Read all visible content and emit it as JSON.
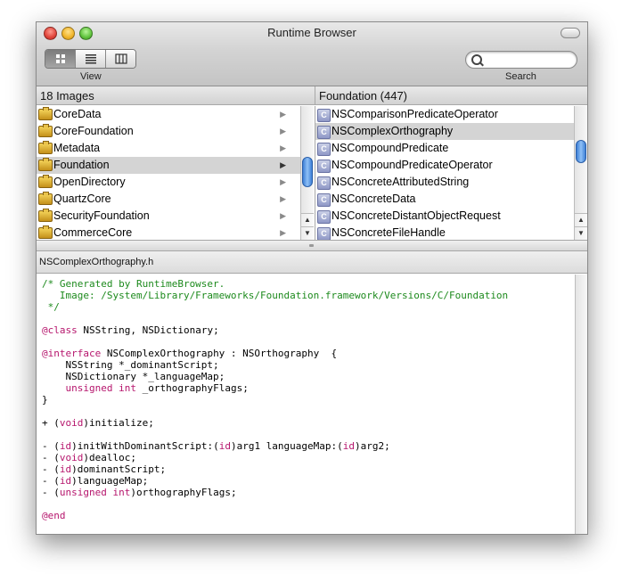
{
  "window": {
    "title": "Runtime Browser"
  },
  "toolbar": {
    "view_label": "View",
    "search_label": "Search",
    "search_value": "",
    "view_modes": [
      "icon-view",
      "list-view",
      "column-view"
    ]
  },
  "images_header": "18 Images",
  "images": [
    {
      "label": "CoreData"
    },
    {
      "label": "CoreFoundation"
    },
    {
      "label": "Metadata"
    },
    {
      "label": "Foundation"
    },
    {
      "label": "OpenDirectory"
    },
    {
      "label": "QuartzCore"
    },
    {
      "label": "SecurityFoundation"
    },
    {
      "label": "CommerceCore"
    }
  ],
  "selected_image_index": 3,
  "classes_header": "Foundation (447)",
  "class_icon_letter": "C",
  "classes": [
    {
      "label": "NSComparisonPredicateOperator"
    },
    {
      "label": "NSComplexOrthography"
    },
    {
      "label": "NSCompoundPredicate"
    },
    {
      "label": "NSCompoundPredicateOperator"
    },
    {
      "label": "NSConcreteAttributedString"
    },
    {
      "label": "NSConcreteData"
    },
    {
      "label": "NSConcreteDistantObjectRequest"
    },
    {
      "label": "NSConcreteFileHandle"
    }
  ],
  "selected_class_index": 1,
  "file_name": "NSComplexOrthography.h",
  "code": {
    "comment_line1": "/* Generated by RuntimeBrowser.",
    "comment_line2": "   Image: /System/Library/Frameworks/Foundation.framework/Versions/C/Foundation",
    "comment_line3": " */",
    "class_kw": "@class",
    "class_rest": " NSString, NSDictionary;",
    "interface_kw": "@interface",
    "interface_rest": " NSComplexOrthography : NSOrthography  {",
    "ivar1": "    NSString *_dominantScript;",
    "ivar2": "    NSDictionary *_languageMap;",
    "ivar3_kw": "unsigned int",
    "ivar3_rest": " _orthographyFlags;",
    "close_brace": "}",
    "m1_prefix": "+ (",
    "m1_kw": "void",
    "m1_rest": ")initialize;",
    "m2_a": "- (",
    "m2_kw1": "id",
    "m2_b": ")initWithDominantScript:(",
    "m2_kw2": "id",
    "m2_c": ")arg1 languageMap:(",
    "m2_kw3": "id",
    "m2_d": ")arg2;",
    "m3_prefix": "- (",
    "m3_kw": "void",
    "m3_rest": ")dealloc;",
    "m4_prefix": "- (",
    "m4_kw": "id",
    "m4_rest": ")dominantScript;",
    "m5_prefix": "- (",
    "m5_kw": "id",
    "m5_rest": ")languageMap;",
    "m6_prefix": "- (",
    "m6_kw": "unsigned int",
    "m6_rest": ")orthographyFlags;",
    "end_kw": "@end"
  }
}
